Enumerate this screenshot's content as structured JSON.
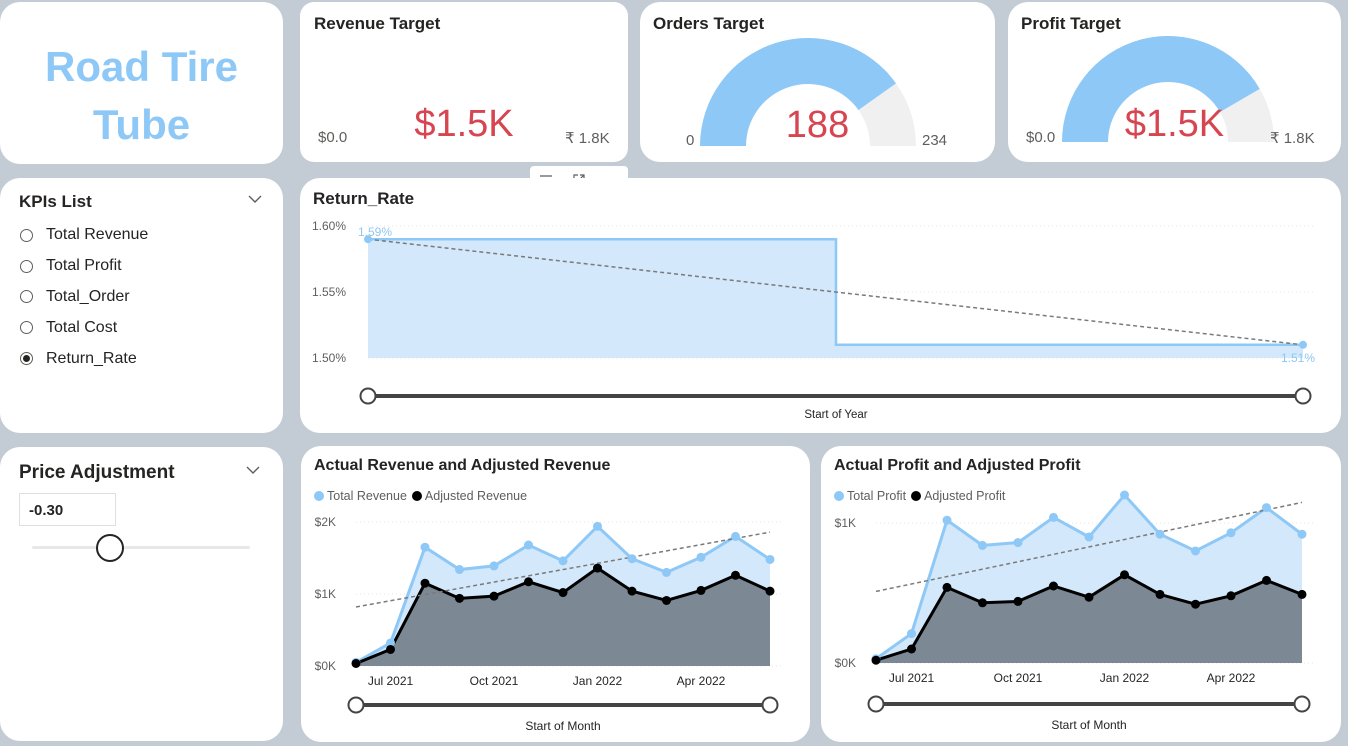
{
  "logo": {
    "line1": "Road Tire",
    "line2": "Tube"
  },
  "gauges": [
    {
      "title": "Revenue Target",
      "value": "$1.5K",
      "min": "$0.0",
      "max": "₹ 1.8K",
      "fraction": 0.833
    },
    {
      "title": "Orders Target",
      "value": "188",
      "min": "0",
      "max": "234",
      "fraction": 0.803
    },
    {
      "title": "Profit Target",
      "value": "$1.5K",
      "min": "$0.0",
      "max": "₹ 1.8K",
      "fraction": 0.833
    }
  ],
  "kpis": {
    "title": "KPIs List",
    "items": [
      {
        "label": "Total Revenue",
        "selected": false
      },
      {
        "label": "Total Profit",
        "selected": false
      },
      {
        "label": "Total_Order",
        "selected": false
      },
      {
        "label": "Total Cost",
        "selected": false
      },
      {
        "label": "Return_Rate",
        "selected": true
      }
    ]
  },
  "price": {
    "title": "Price Adjustment",
    "value": "-0.30",
    "slider_fraction": 0.36
  },
  "colors": {
    "accent": "#8ec8f6",
    "area": "#d3e8fb",
    "dark_area": "#7c8995",
    "value_red": "#d64550",
    "gauge_empty": "#f0f0f0"
  },
  "icons": {
    "filter": "filter-icon",
    "focus": "focus-mode-icon",
    "more": "more-options-icon",
    "dropdown": "chevron-down-icon"
  },
  "chart_data": [
    {
      "id": "return_rate",
      "type": "area",
      "title": "Return_Rate",
      "xlabel": "Start of Year",
      "ylabel": "",
      "ylim": [
        1.5,
        1.6
      ],
      "yticks": [
        "1.60%",
        "1.55%",
        "1.50%"
      ],
      "step": true,
      "trendline": true,
      "series": [
        {
          "values": [
            1.59,
            1.51
          ],
          "labels": [
            "1.59%",
            "1.51%"
          ]
        }
      ],
      "grid": true
    },
    {
      "id": "revenue",
      "type": "area",
      "title": "Actual Revenue and Adjusted Revenue",
      "xlabel": "Start of Month",
      "ylim": [
        0,
        2000
      ],
      "yticks": [
        "$2K",
        "$1K",
        "$0K"
      ],
      "xticks": [
        "Jul 2021",
        "Oct 2021",
        "Jan 2022",
        "Apr 2022"
      ],
      "legend": "top-left",
      "trendline": true,
      "series": [
        {
          "name": "Total Revenue",
          "values": [
            50,
            320,
            1650,
            1340,
            1390,
            1680,
            1460,
            1940,
            1490,
            1300,
            1510,
            1800,
            1480
          ]
        },
        {
          "name": "Adjusted Revenue",
          "values": [
            35,
            230,
            1150,
            940,
            970,
            1170,
            1020,
            1360,
            1040,
            910,
            1050,
            1260,
            1040
          ]
        }
      ]
    },
    {
      "id": "profit",
      "type": "area",
      "title": "Actual Profit and Adjusted Profit",
      "xlabel": "Start of Month",
      "ylim": [
        0,
        1000
      ],
      "yticks": [
        "$1K",
        "$0K"
      ],
      "xticks": [
        "Jul 2021",
        "Oct 2021",
        "Jan 2022",
        "Apr 2022"
      ],
      "legend": "top-left",
      "trendline": true,
      "series": [
        {
          "name": "Total Profit",
          "values": [
            30,
            210,
            1020,
            840,
            860,
            1040,
            900,
            1200,
            920,
            800,
            930,
            1110,
            920
          ]
        },
        {
          "name": "Adjusted Profit",
          "values": [
            20,
            100,
            540,
            430,
            440,
            550,
            470,
            630,
            490,
            420,
            480,
            590,
            490
          ]
        }
      ]
    }
  ]
}
